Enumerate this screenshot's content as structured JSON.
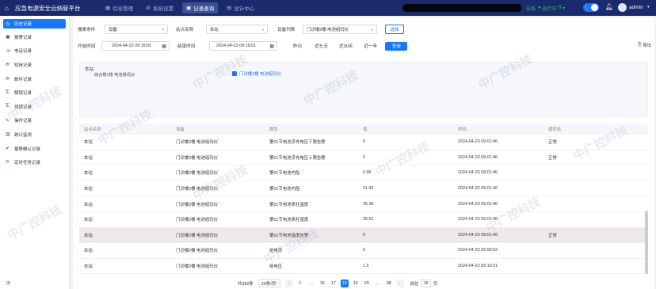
{
  "app": {
    "title": "应急电源安全云纳管平台"
  },
  "nav": [
    {
      "label": "综合管理",
      "icon": "grid-icon",
      "glyph": "▦",
      "active": false
    },
    {
      "label": "系统设置",
      "icon": "gear-icon",
      "glyph": "⚙",
      "active": false
    },
    {
      "label": "记录查询",
      "icon": "record-icon",
      "glyph": "▣",
      "active": true
    },
    {
      "label": "设计中心",
      "icon": "design-icon",
      "glyph": "▤",
      "active": false
    }
  ],
  "header": {
    "online": "在线",
    "run_status": "运行中",
    "run_suffix": "H",
    "user": "admin"
  },
  "sidebar": {
    "items": [
      {
        "label": "历史记录",
        "glyph": "◷",
        "active": true
      },
      {
        "label": "报警记录",
        "glyph": "▣",
        "active": false
      },
      {
        "label": "电话记录",
        "glyph": "☏",
        "active": false
      },
      {
        "label": "短信记录",
        "glyph": "✉",
        "active": false
      },
      {
        "label": "邮件记录",
        "glyph": "✉",
        "active": false
      },
      {
        "label": "解锁记录",
        "glyph": "⚿",
        "active": false
      },
      {
        "label": "领锁记录",
        "glyph": "⚿",
        "active": false
      },
      {
        "label": "操作记录",
        "glyph": "✎",
        "active": false
      },
      {
        "label": "统计监测",
        "glyph": "▥",
        "active": false
      },
      {
        "label": "报警确认记录",
        "glyph": "✔",
        "active": false
      },
      {
        "label": "定时任务记录",
        "glyph": "⏲",
        "active": false
      }
    ],
    "collapse_glyph": "⊞"
  },
  "filters": {
    "search_cond_label": "搜索条件",
    "search_cond_value": "设备",
    "station_label": "站点名称",
    "station_value": "本站",
    "device_label": "设备列表",
    "device_value": "门诊楼2楼 电池组玛仪",
    "select_button": "选择",
    "start_label": "开始时间",
    "start_value": "2024-04-22 09:19:01",
    "end_label": "结束时间",
    "end_value": "2024-04-23 09:19:01",
    "quick": [
      "昨日",
      "近七天",
      "近30天",
      "近一年"
    ],
    "query_button": "查询",
    "export_label": "导出"
  },
  "tree": {
    "root": "本站",
    "child": "综合楼1楼 电池组玛仪",
    "checked": "门诊楼2楼 电池组玛仪"
  },
  "table": {
    "headers": [
      "站点名称",
      "设备",
      "属性",
      "值",
      "时间",
      "值状态"
    ],
    "rows": [
      [
        "本站",
        "门诊楼2楼 电池组玛仪",
        "第01节电池浮充电压下限告警",
        "0",
        "2024-04-23 09:01:46",
        "正常"
      ],
      [
        "本站",
        "门诊楼2楼 电池组玛仪",
        "第01节电池浮充电压上限告警",
        "0",
        "2024-04-23 09:01:46",
        "正常"
      ],
      [
        "本站",
        "门诊楼2楼 电池组玛仪",
        "第01节电池内阻",
        "6.96",
        "2024-04-23 09:01:46",
        ""
      ],
      [
        "本站",
        "门诊楼2楼 电池组玛仪",
        "第01节电池内阻",
        "11.43",
        "2024-04-23 09:01:46",
        ""
      ],
      [
        "本站",
        "门诊楼2楼 电池组玛仪",
        "第01节电池表柱温度",
        "26.36",
        "2024-04-23 09:01:46",
        ""
      ],
      [
        "本站",
        "门诊楼2楼 电池组玛仪",
        "第01节电池表柱温度",
        "26.61",
        "2024-04-23 09:01:46",
        ""
      ],
      [
        "本站",
        "门诊楼2楼 电池组玛仪",
        "第01节电池温度告警",
        "0",
        "2024-04-23 09:01:46",
        "正常"
      ],
      [
        "本站",
        "门诊楼2楼 电池组玛仪",
        "组电流",
        "0",
        "2024-04-23 09:09:02",
        ""
      ],
      [
        "本站",
        "门诊楼2楼 电池组玛仪",
        "组电压",
        "1.5",
        "2024-04-23 09:10:21",
        ""
      ]
    ],
    "highlight_row": 6
  },
  "pager": {
    "total": "共382条",
    "page_size": "20条/页",
    "pages": [
      "1",
      "…",
      "16",
      "17",
      "18",
      "19",
      "20",
      "…",
      "38"
    ],
    "active_page": "18",
    "goto_label": "前往",
    "goto_value": "16",
    "page_suffix": "页"
  },
  "watermark": "中广控科技"
}
